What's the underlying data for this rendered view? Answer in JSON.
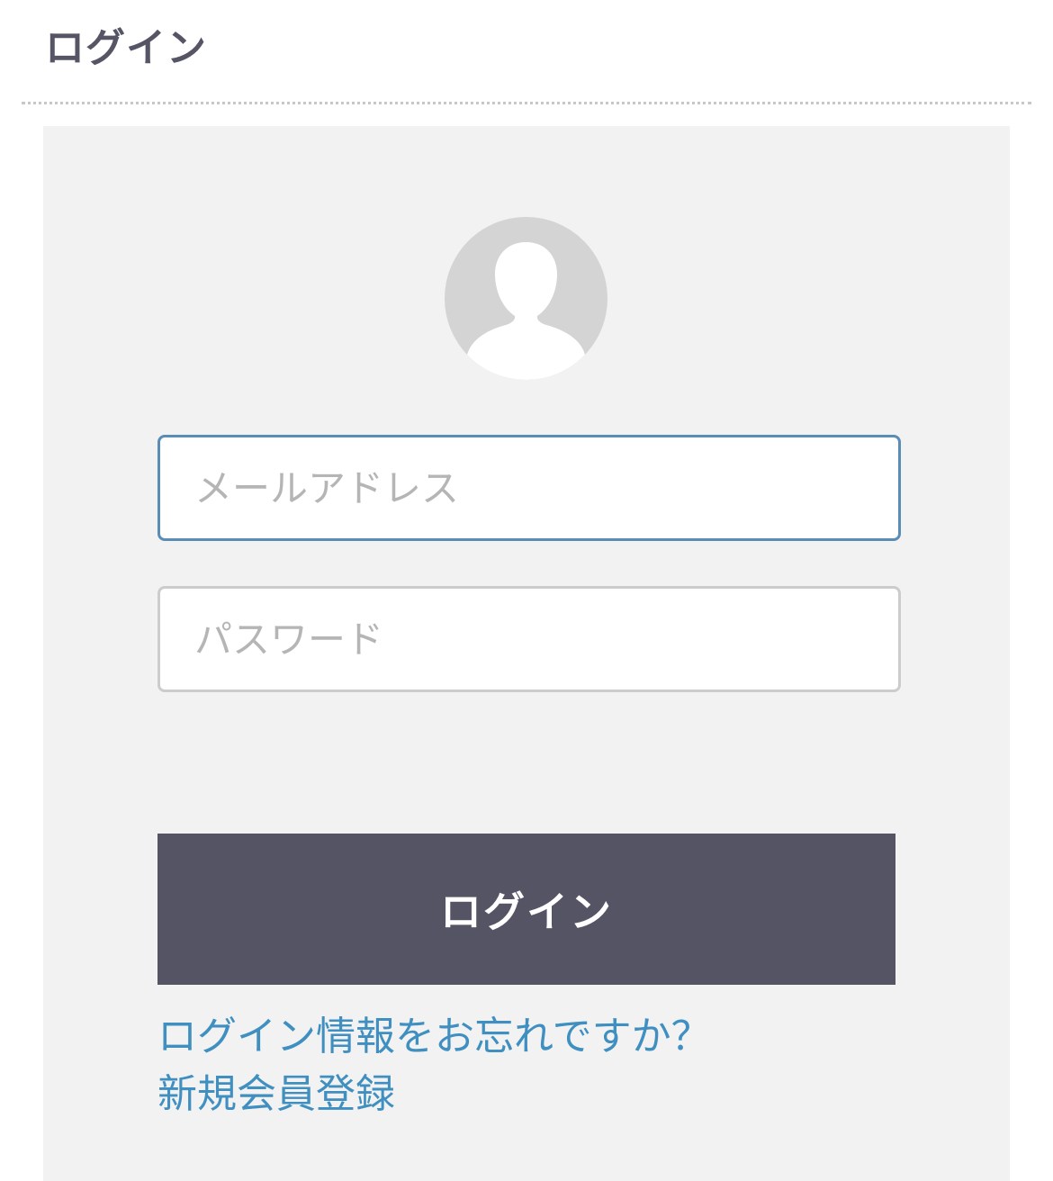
{
  "header": {
    "title": "ログイン"
  },
  "login_form": {
    "avatar_icon": "user-silhouette-icon",
    "email": {
      "value": "",
      "placeholder": "メールアドレス"
    },
    "password": {
      "value": "",
      "placeholder": "パスワード"
    },
    "submit_label": "ログイン",
    "forgot_link": "ログイン情報をお忘れですか？",
    "register_link": "新規会員登録"
  },
  "colors": {
    "title_text": "#555565",
    "panel_background": "#f2f2f2",
    "button_background": "#545464",
    "link": "#3f8fc0",
    "focused_border": "#5a8db5"
  }
}
